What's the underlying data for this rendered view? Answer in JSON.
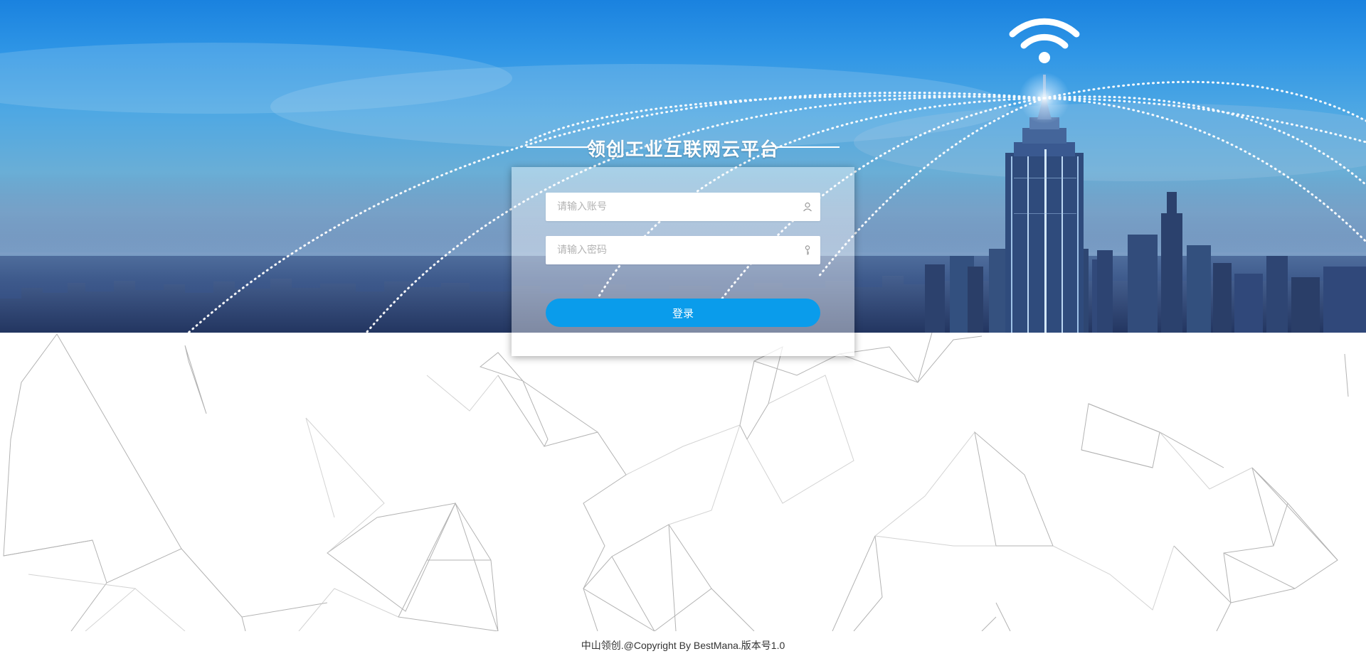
{
  "app": {
    "title": "领创工业互联网云平台"
  },
  "login": {
    "account_placeholder": "请输入账号",
    "password_placeholder": "请输入密码",
    "submit_label": "登录",
    "account_icon": "user-icon",
    "password_icon": "key-icon"
  },
  "footer": {
    "text": "中山领创.@Copyright By BestMana.版本号1.0"
  },
  "colors": {
    "accent": "#0a9ceb",
    "banner_sky": "#2f96e6",
    "title_text": "#ffffff",
    "footer_text": "#333333"
  },
  "decor": {
    "banner_image": "city-skyline-with-wifi-tower",
    "background_pattern": "polygon-network-lines"
  }
}
